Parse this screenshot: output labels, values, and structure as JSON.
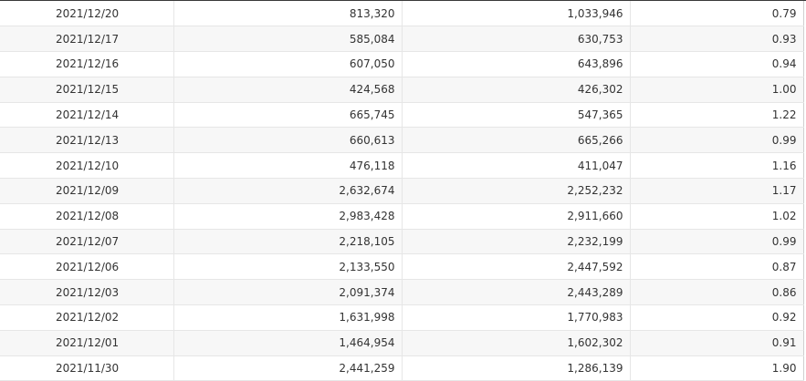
{
  "table": {
    "rows": [
      {
        "date": "2021/12/20",
        "col_a": "813,320",
        "col_b": "1,033,946",
        "ratio": "0.79"
      },
      {
        "date": "2021/12/17",
        "col_a": "585,084",
        "col_b": "630,753",
        "ratio": "0.93"
      },
      {
        "date": "2021/12/16",
        "col_a": "607,050",
        "col_b": "643,896",
        "ratio": "0.94"
      },
      {
        "date": "2021/12/15",
        "col_a": "424,568",
        "col_b": "426,302",
        "ratio": "1.00"
      },
      {
        "date": "2021/12/14",
        "col_a": "665,745",
        "col_b": "547,365",
        "ratio": "1.22"
      },
      {
        "date": "2021/12/13",
        "col_a": "660,613",
        "col_b": "665,266",
        "ratio": "0.99"
      },
      {
        "date": "2021/12/10",
        "col_a": "476,118",
        "col_b": "411,047",
        "ratio": "1.16"
      },
      {
        "date": "2021/12/09",
        "col_a": "2,632,674",
        "col_b": "2,252,232",
        "ratio": "1.17"
      },
      {
        "date": "2021/12/08",
        "col_a": "2,983,428",
        "col_b": "2,911,660",
        "ratio": "1.02"
      },
      {
        "date": "2021/12/07",
        "col_a": "2,218,105",
        "col_b": "2,232,199",
        "ratio": "0.99"
      },
      {
        "date": "2021/12/06",
        "col_a": "2,133,550",
        "col_b": "2,447,592",
        "ratio": "0.87"
      },
      {
        "date": "2021/12/03",
        "col_a": "2,091,374",
        "col_b": "2,443,289",
        "ratio": "0.86"
      },
      {
        "date": "2021/12/02",
        "col_a": "1,631,998",
        "col_b": "1,770,983",
        "ratio": "0.92"
      },
      {
        "date": "2021/12/01",
        "col_a": "1,464,954",
        "col_b": "1,602,302",
        "ratio": "0.91"
      },
      {
        "date": "2021/11/30",
        "col_a": "2,441,259",
        "col_b": "1,286,139",
        "ratio": "1.90"
      }
    ]
  }
}
